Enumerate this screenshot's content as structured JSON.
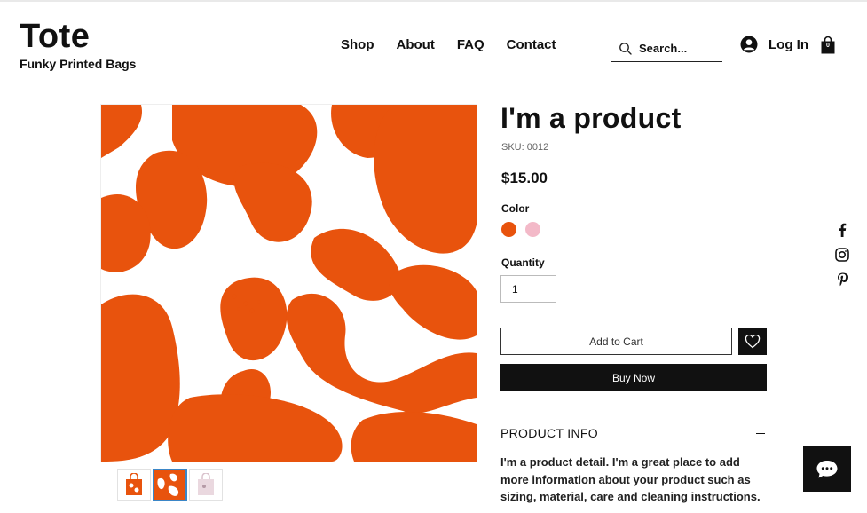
{
  "site": {
    "title": "Tote",
    "subtitle": "Funky Printed Bags"
  },
  "nav": {
    "items": [
      "Shop",
      "About",
      "FAQ",
      "Contact"
    ]
  },
  "search": {
    "placeholder": "Search...",
    "icon": "search-icon"
  },
  "account": {
    "login_label": "Log In",
    "icon": "user-icon"
  },
  "cart": {
    "count": "0",
    "icon": "shopping-bag-icon"
  },
  "product": {
    "title": "I'm a product",
    "sku": "SKU: 0012",
    "price": "$15.00",
    "color_label": "Color",
    "colors": [
      "#e8530d",
      "#f3b9c8"
    ],
    "quantity_label": "Quantity",
    "quantity_value": "1",
    "add_to_cart_label": "Add to Cart",
    "buy_now_label": "Buy Now",
    "wishlist_icon": "heart-icon",
    "info_title": "PRODUCT INFO",
    "info_text": "I'm a product detail. I'm a great place to add more information about your product such as sizing, material, care and cleaning instructions.",
    "thumbnails": [
      "orange-tote-bag",
      "orange-pattern",
      "pink-tote-bag"
    ]
  },
  "social": [
    "facebook-icon",
    "instagram-icon",
    "pinterest-icon"
  ],
  "chat": {
    "icon": "chat-icon"
  },
  "colors": {
    "accent": "#e8530d",
    "dark": "#111111",
    "thumb_selected": "#3b86c7"
  }
}
